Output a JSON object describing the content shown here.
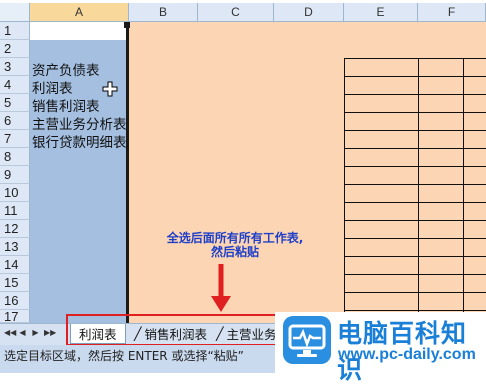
{
  "columns": [
    "A",
    "B",
    "C",
    "D",
    "E",
    "F"
  ],
  "rows": [
    "1",
    "2",
    "3",
    "4",
    "5",
    "6",
    "7",
    "8",
    "9",
    "10",
    "11",
    "12",
    "13",
    "14",
    "15",
    "16",
    "17"
  ],
  "cells_A": [
    {
      "row": "3",
      "text": "资产负债表"
    },
    {
      "row": "4",
      "text": "利润表"
    },
    {
      "row": "5",
      "text": "销售利润表"
    },
    {
      "row": "6",
      "text": "主营业务分析表"
    },
    {
      "row": "7",
      "text": "银行贷款明细表"
    }
  ],
  "annotation": {
    "line1": "全选后面所有所有工作表,",
    "line2": "然后粘贴"
  },
  "sheet_tabs": [
    {
      "label": "利润表"
    },
    {
      "label": "销售利润表"
    },
    {
      "label": "主营业务"
    }
  ],
  "nav_buttons": [
    "◀◀",
    "◀",
    "▶",
    "▶▶"
  ],
  "status_text": "选定目标区域，然后按 ENTER 或选择“粘贴”",
  "watermark": {
    "title": "电脑百科知识",
    "url": "www.pc-daily.com"
  },
  "colors": {
    "selected_column": "#a4bfe0",
    "sheet_fill": "#fcd5b4",
    "annotation_blue": "#1e3fc8",
    "highlight_red": "#e02020",
    "logo_blue": "#1a7fd6"
  }
}
